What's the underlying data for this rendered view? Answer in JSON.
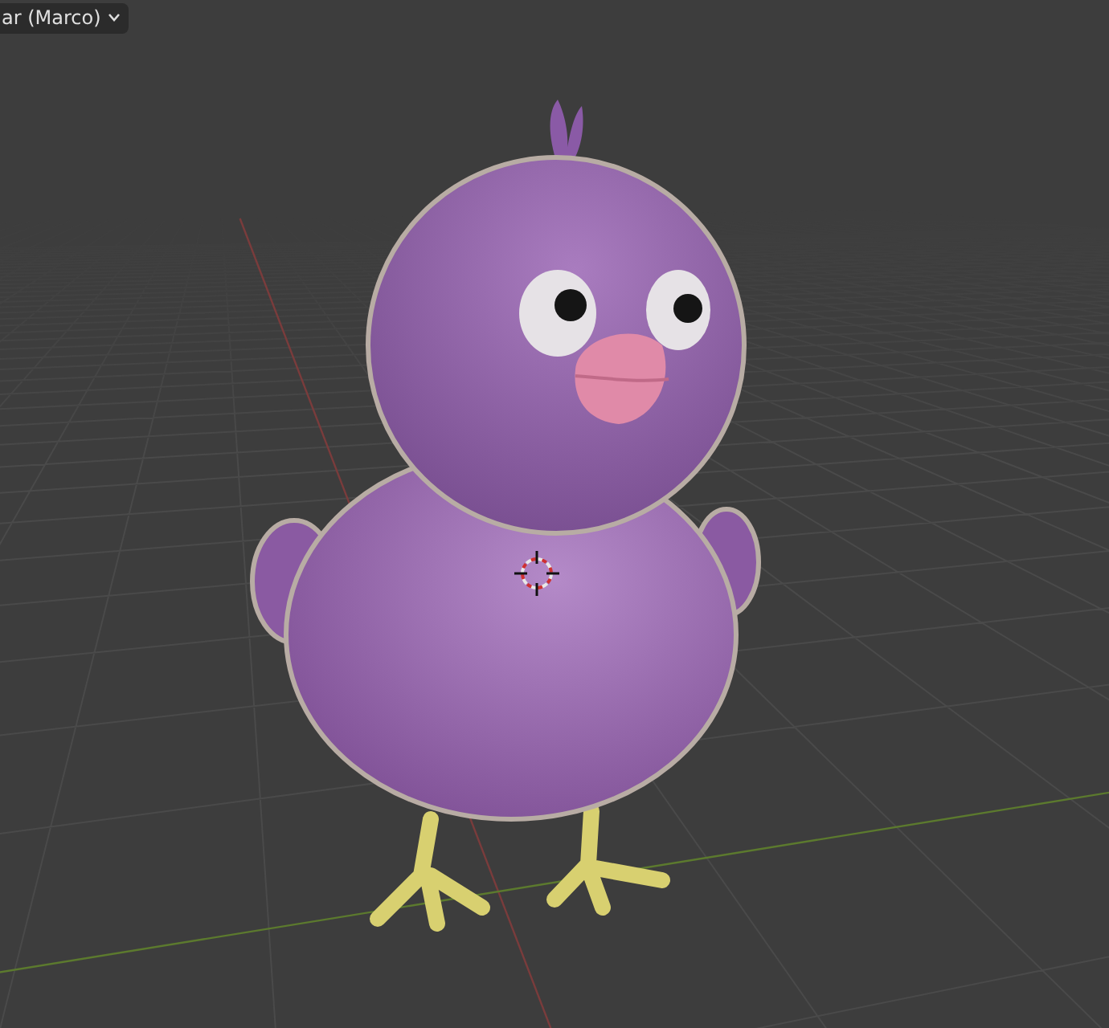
{
  "viewport": {
    "object_menu": {
      "label": "ar (Marco)"
    }
  }
}
